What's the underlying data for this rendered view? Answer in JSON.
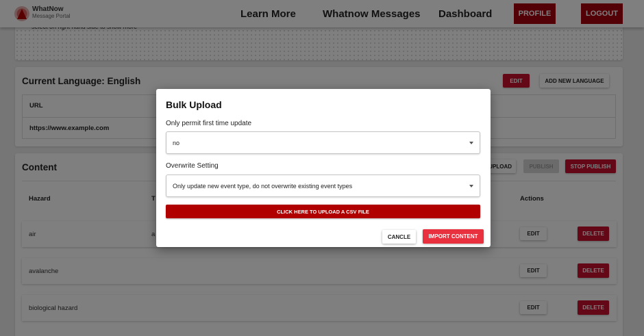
{
  "header": {
    "brand_name": "WhatNow",
    "brand_sub": "Message Portal",
    "nav": [
      "Learn More",
      "Whatnow Messages",
      "Dashboard"
    ],
    "profile_label": "PROFILE",
    "logout_label": "LOGOUT"
  },
  "top_card": {
    "hint": "select on right hand side to show more"
  },
  "language": {
    "title": "Current Language: English",
    "edit_label": "EDIT",
    "add_label": "ADD NEW LANGUAGE",
    "url_header": "URL",
    "url_value": "https://www.example.com"
  },
  "content": {
    "title": "Content",
    "upload_label": "UPLOAD",
    "publish_label": "PUBLISH",
    "stop_publish_label": "STOP PUBLISH",
    "columns": {
      "hazard": "Hazard",
      "type": "T",
      "actions": "Actions"
    },
    "rows": [
      {
        "hazard": "air",
        "type": "a",
        "edit": "EDIT",
        "delete": "DELETE"
      },
      {
        "hazard": "avalanche",
        "type": "",
        "edit": "EDIT",
        "delete": "DELETE"
      },
      {
        "hazard": "biological hazard",
        "type": "",
        "edit": "EDIT",
        "delete": "DELETE"
      }
    ]
  },
  "modal": {
    "title": "Bulk Upload",
    "first_time_label": "Only permit first time update",
    "first_time_value": "no",
    "overwrite_label": "Overwrite Setting",
    "overwrite_value": "Only update new event type, do not overwrite existing event types",
    "upload_csv_label": "CLICK HERE TO UPLOAD A CSV FILE",
    "cancel_label": "CANCLE",
    "import_label": "IMPORT CONTENT"
  },
  "colors": {
    "brand_red": "#a6000f",
    "accent_red": "#c8102e",
    "import_red": "#e8303f",
    "overlay": "rgba(0,0,0,0.5)"
  },
  "icons": [
    "whatnow-logo-icon",
    "caret-down-icon"
  ]
}
